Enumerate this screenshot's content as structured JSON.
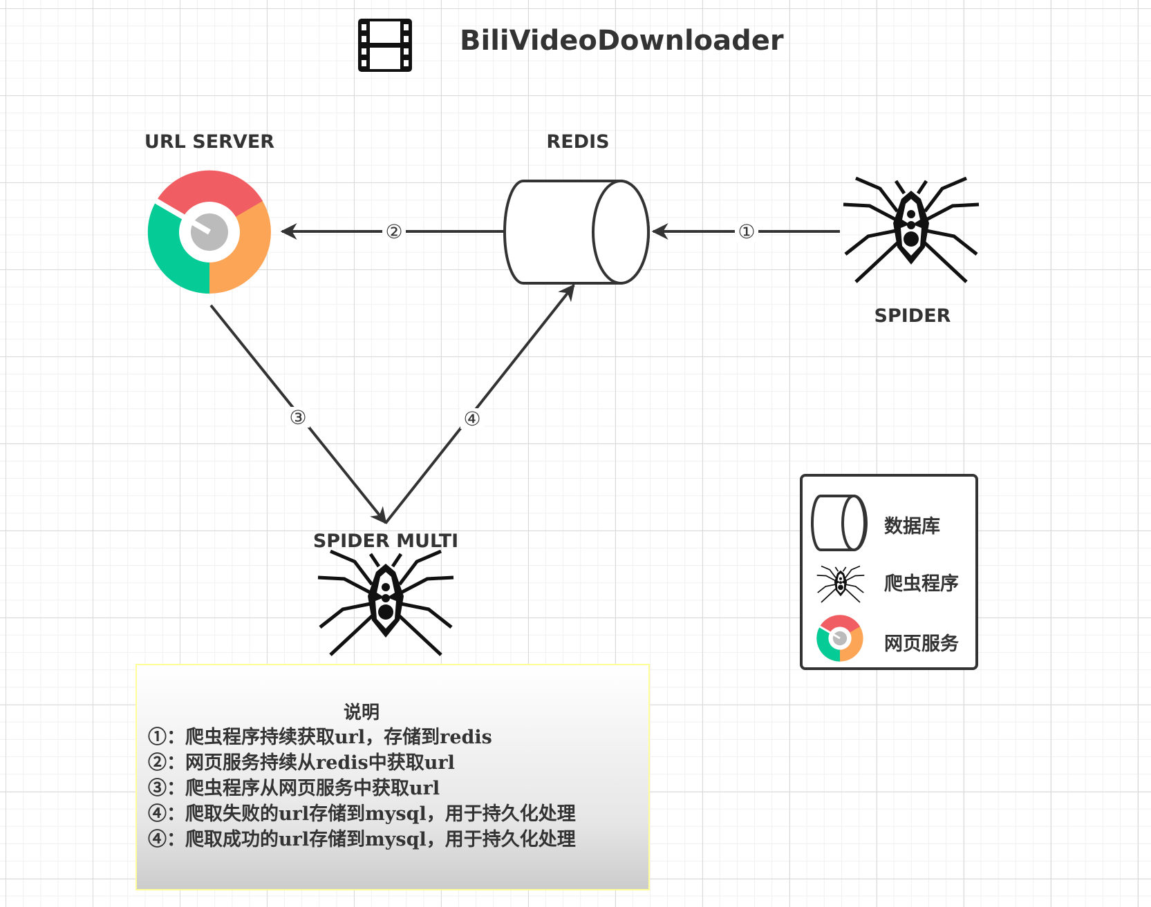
{
  "title": "BiliVideoDownloader",
  "nodes": {
    "url_server": "URL SERVER",
    "redis": "REDIS",
    "spider": "SPIDER",
    "spider_multi": "SPIDER MULTI"
  },
  "edges": [
    {
      "from": "spider",
      "to": "redis",
      "label": "①"
    },
    {
      "from": "redis",
      "to": "url_server",
      "label": "②"
    },
    {
      "from": "url_server",
      "to": "spider_multi",
      "label": "③"
    },
    {
      "from": "spider_multi",
      "to": "redis",
      "label": "④"
    }
  ],
  "legend": {
    "database": "数据库",
    "spider_program": "爬虫程序",
    "web_service": "网页服务"
  },
  "notes": {
    "title": "说明",
    "items": [
      "①：爬虫程序持续获取url，存储到redis",
      "②：网页服务持续从redis中获取url",
      "③：爬虫程序从网页服务中获取url",
      "④：爬取失败的url存储到mysql，用于持久化处理",
      "④：爬取成功的url存储到mysql，用于持久化处理"
    ]
  },
  "colors": {
    "chrome_red": "#f05d63",
    "chrome_green": "#05cc97",
    "chrome_orange": "#fca556",
    "chrome_center": "#bbbbbb",
    "stroke": "#333333",
    "notes_border": "#ffff99"
  },
  "icons": [
    "film-icon",
    "chrome-icon",
    "database-cylinder-icon",
    "spider-icon"
  ]
}
